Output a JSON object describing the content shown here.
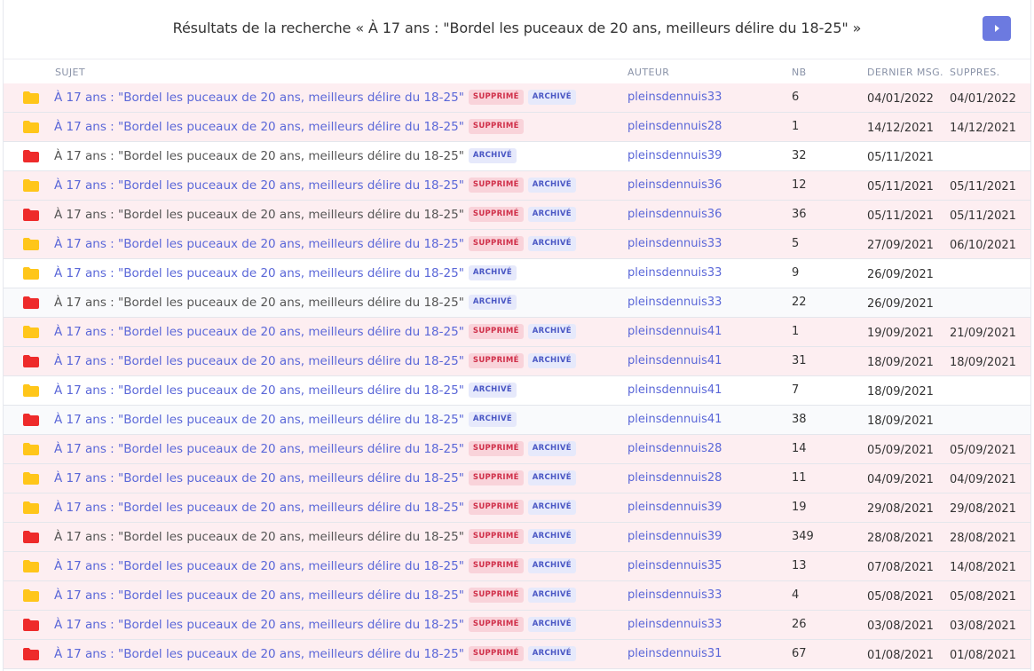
{
  "header": {
    "title": "Résultats de la recherche « À 17 ans : \"Bordel les puceaux de 20 ans, meilleurs délire du 18-25\" »",
    "next_icon": "caret-right-icon"
  },
  "columns": {
    "subject": "SUJET",
    "author": "AUTEUR",
    "nb": "NB",
    "last": "DERNIER MSG.",
    "deleted": "SUPPRES."
  },
  "badges": {
    "deleted": "SUPPRIMÉ",
    "archived": "ARCHIVÉ"
  },
  "colors": {
    "folder_yellow": "#ffc61a",
    "folder_red": "#ee2b2b",
    "link": "#5a67d8",
    "button": "#6c7ae0"
  },
  "rows": [
    {
      "subject": "À 17 ans : \"Bordel les puceaux de 20 ans, meilleurs délire du 18-25\"",
      "link": true,
      "folder": "yellow",
      "supprime": true,
      "archive": true,
      "author": "pleinsdennuis33",
      "nb": "6",
      "last": "04/01/2022",
      "deleted": "04/01/2022"
    },
    {
      "subject": "À 17 ans : \"Bordel les puceaux de 20 ans, meilleurs délire du 18-25\"",
      "link": true,
      "folder": "yellow",
      "supprime": true,
      "archive": false,
      "author": "pleinsdennuis28",
      "nb": "1",
      "last": "14/12/2021",
      "deleted": "14/12/2021"
    },
    {
      "subject": "À 17 ans : \"Bordel les puceaux de 20 ans, meilleurs délire du 18-25\"",
      "link": false,
      "folder": "red",
      "supprime": false,
      "archive": true,
      "author": "pleinsdennuis39",
      "nb": "32",
      "last": "05/11/2021",
      "deleted": ""
    },
    {
      "subject": "À 17 ans : \"Bordel les puceaux de 20 ans, meilleurs délire du 18-25\"",
      "link": true,
      "folder": "yellow",
      "supprime": true,
      "archive": true,
      "author": "pleinsdennuis36",
      "nb": "12",
      "last": "05/11/2021",
      "deleted": "05/11/2021"
    },
    {
      "subject": "À 17 ans : \"Bordel les puceaux de 20 ans, meilleurs délire du 18-25\"",
      "link": false,
      "folder": "red",
      "supprime": true,
      "archive": true,
      "author": "pleinsdennuis36",
      "nb": "36",
      "last": "05/11/2021",
      "deleted": "05/11/2021"
    },
    {
      "subject": "À 17 ans : \"Bordel les puceaux de 20 ans, meilleurs délire du 18-25\"",
      "link": true,
      "folder": "yellow",
      "supprime": true,
      "archive": true,
      "author": "pleinsdennuis33",
      "nb": "5",
      "last": "27/09/2021",
      "deleted": "06/10/2021"
    },
    {
      "subject": "À 17 ans : \"Bordel les puceaux de 20 ans, meilleurs délire du 18-25\"",
      "link": true,
      "folder": "yellow",
      "supprime": false,
      "archive": true,
      "author": "pleinsdennuis33",
      "nb": "9",
      "last": "26/09/2021",
      "deleted": ""
    },
    {
      "subject": "À 17 ans : \"Bordel les puceaux de 20 ans, meilleurs délire du 18-25\"",
      "link": false,
      "folder": "red",
      "supprime": false,
      "archive": true,
      "author": "pleinsdennuis33",
      "nb": "22",
      "last": "26/09/2021",
      "deleted": ""
    },
    {
      "subject": "À 17 ans : \"Bordel les puceaux de 20 ans, meilleurs délire du 18-25\"",
      "link": true,
      "folder": "yellow",
      "supprime": true,
      "archive": true,
      "author": "pleinsdennuis41",
      "nb": "1",
      "last": "19/09/2021",
      "deleted": "21/09/2021"
    },
    {
      "subject": "À 17 ans : \"Bordel les puceaux de 20 ans, meilleurs délire du 18-25\"",
      "link": true,
      "folder": "red",
      "supprime": true,
      "archive": true,
      "author": "pleinsdennuis41",
      "nb": "31",
      "last": "18/09/2021",
      "deleted": "18/09/2021"
    },
    {
      "subject": "À 17 ans : \"Bordel les puceaux de 20 ans, meilleurs délire du 18-25\"",
      "link": true,
      "folder": "yellow",
      "supprime": false,
      "archive": true,
      "author": "pleinsdennuis41",
      "nb": "7",
      "last": "18/09/2021",
      "deleted": ""
    },
    {
      "subject": "À 17 ans : \"Bordel les puceaux de 20 ans, meilleurs délire du 18-25\"",
      "link": true,
      "folder": "red",
      "supprime": false,
      "archive": true,
      "author": "pleinsdennuis41",
      "nb": "38",
      "last": "18/09/2021",
      "deleted": ""
    },
    {
      "subject": "À 17 ans : \"Bordel les puceaux de 20 ans, meilleurs délire du 18-25\"",
      "link": true,
      "folder": "yellow",
      "supprime": true,
      "archive": true,
      "author": "pleinsdennuis28",
      "nb": "14",
      "last": "05/09/2021",
      "deleted": "05/09/2021"
    },
    {
      "subject": "À 17 ans : \"Bordel les puceaux de 20 ans, meilleurs délire du 18-25\"",
      "link": true,
      "folder": "yellow",
      "supprime": true,
      "archive": true,
      "author": "pleinsdennuis28",
      "nb": "11",
      "last": "04/09/2021",
      "deleted": "04/09/2021"
    },
    {
      "subject": "À 17 ans : \"Bordel les puceaux de 20 ans, meilleurs délire du 18-25\"",
      "link": true,
      "folder": "yellow",
      "supprime": true,
      "archive": true,
      "author": "pleinsdennuis39",
      "nb": "19",
      "last": "29/08/2021",
      "deleted": "29/08/2021"
    },
    {
      "subject": "À 17 ans : \"Bordel les puceaux de 20 ans, meilleurs délire du 18-25\"",
      "link": false,
      "folder": "red",
      "supprime": true,
      "archive": true,
      "author": "pleinsdennuis39",
      "nb": "349",
      "last": "28/08/2021",
      "deleted": "28/08/2021"
    },
    {
      "subject": "À 17 ans : \"Bordel les puceaux de 20 ans, meilleurs délire du 18-25\"",
      "link": true,
      "folder": "yellow",
      "supprime": true,
      "archive": true,
      "author": "pleinsdennuis35",
      "nb": "13",
      "last": "07/08/2021",
      "deleted": "14/08/2021"
    },
    {
      "subject": "À 17 ans : \"Bordel les puceaux de 20 ans, meilleurs délire du 18-25\"",
      "link": true,
      "folder": "yellow",
      "supprime": true,
      "archive": true,
      "author": "pleinsdennuis33",
      "nb": "4",
      "last": "05/08/2021",
      "deleted": "05/08/2021"
    },
    {
      "subject": "À 17 ans : \"Bordel les puceaux de 20 ans, meilleurs délire du 18-25\"",
      "link": true,
      "folder": "red",
      "supprime": true,
      "archive": true,
      "author": "pleinsdennuis33",
      "nb": "26",
      "last": "03/08/2021",
      "deleted": "03/08/2021"
    },
    {
      "subject": "À 17 ans : \"Bordel les puceaux de 20 ans, meilleurs délire du 18-25\"",
      "link": true,
      "folder": "red",
      "supprime": true,
      "archive": true,
      "author": "pleinsdennuis31",
      "nb": "67",
      "last": "01/08/2021",
      "deleted": "01/08/2021"
    }
  ]
}
